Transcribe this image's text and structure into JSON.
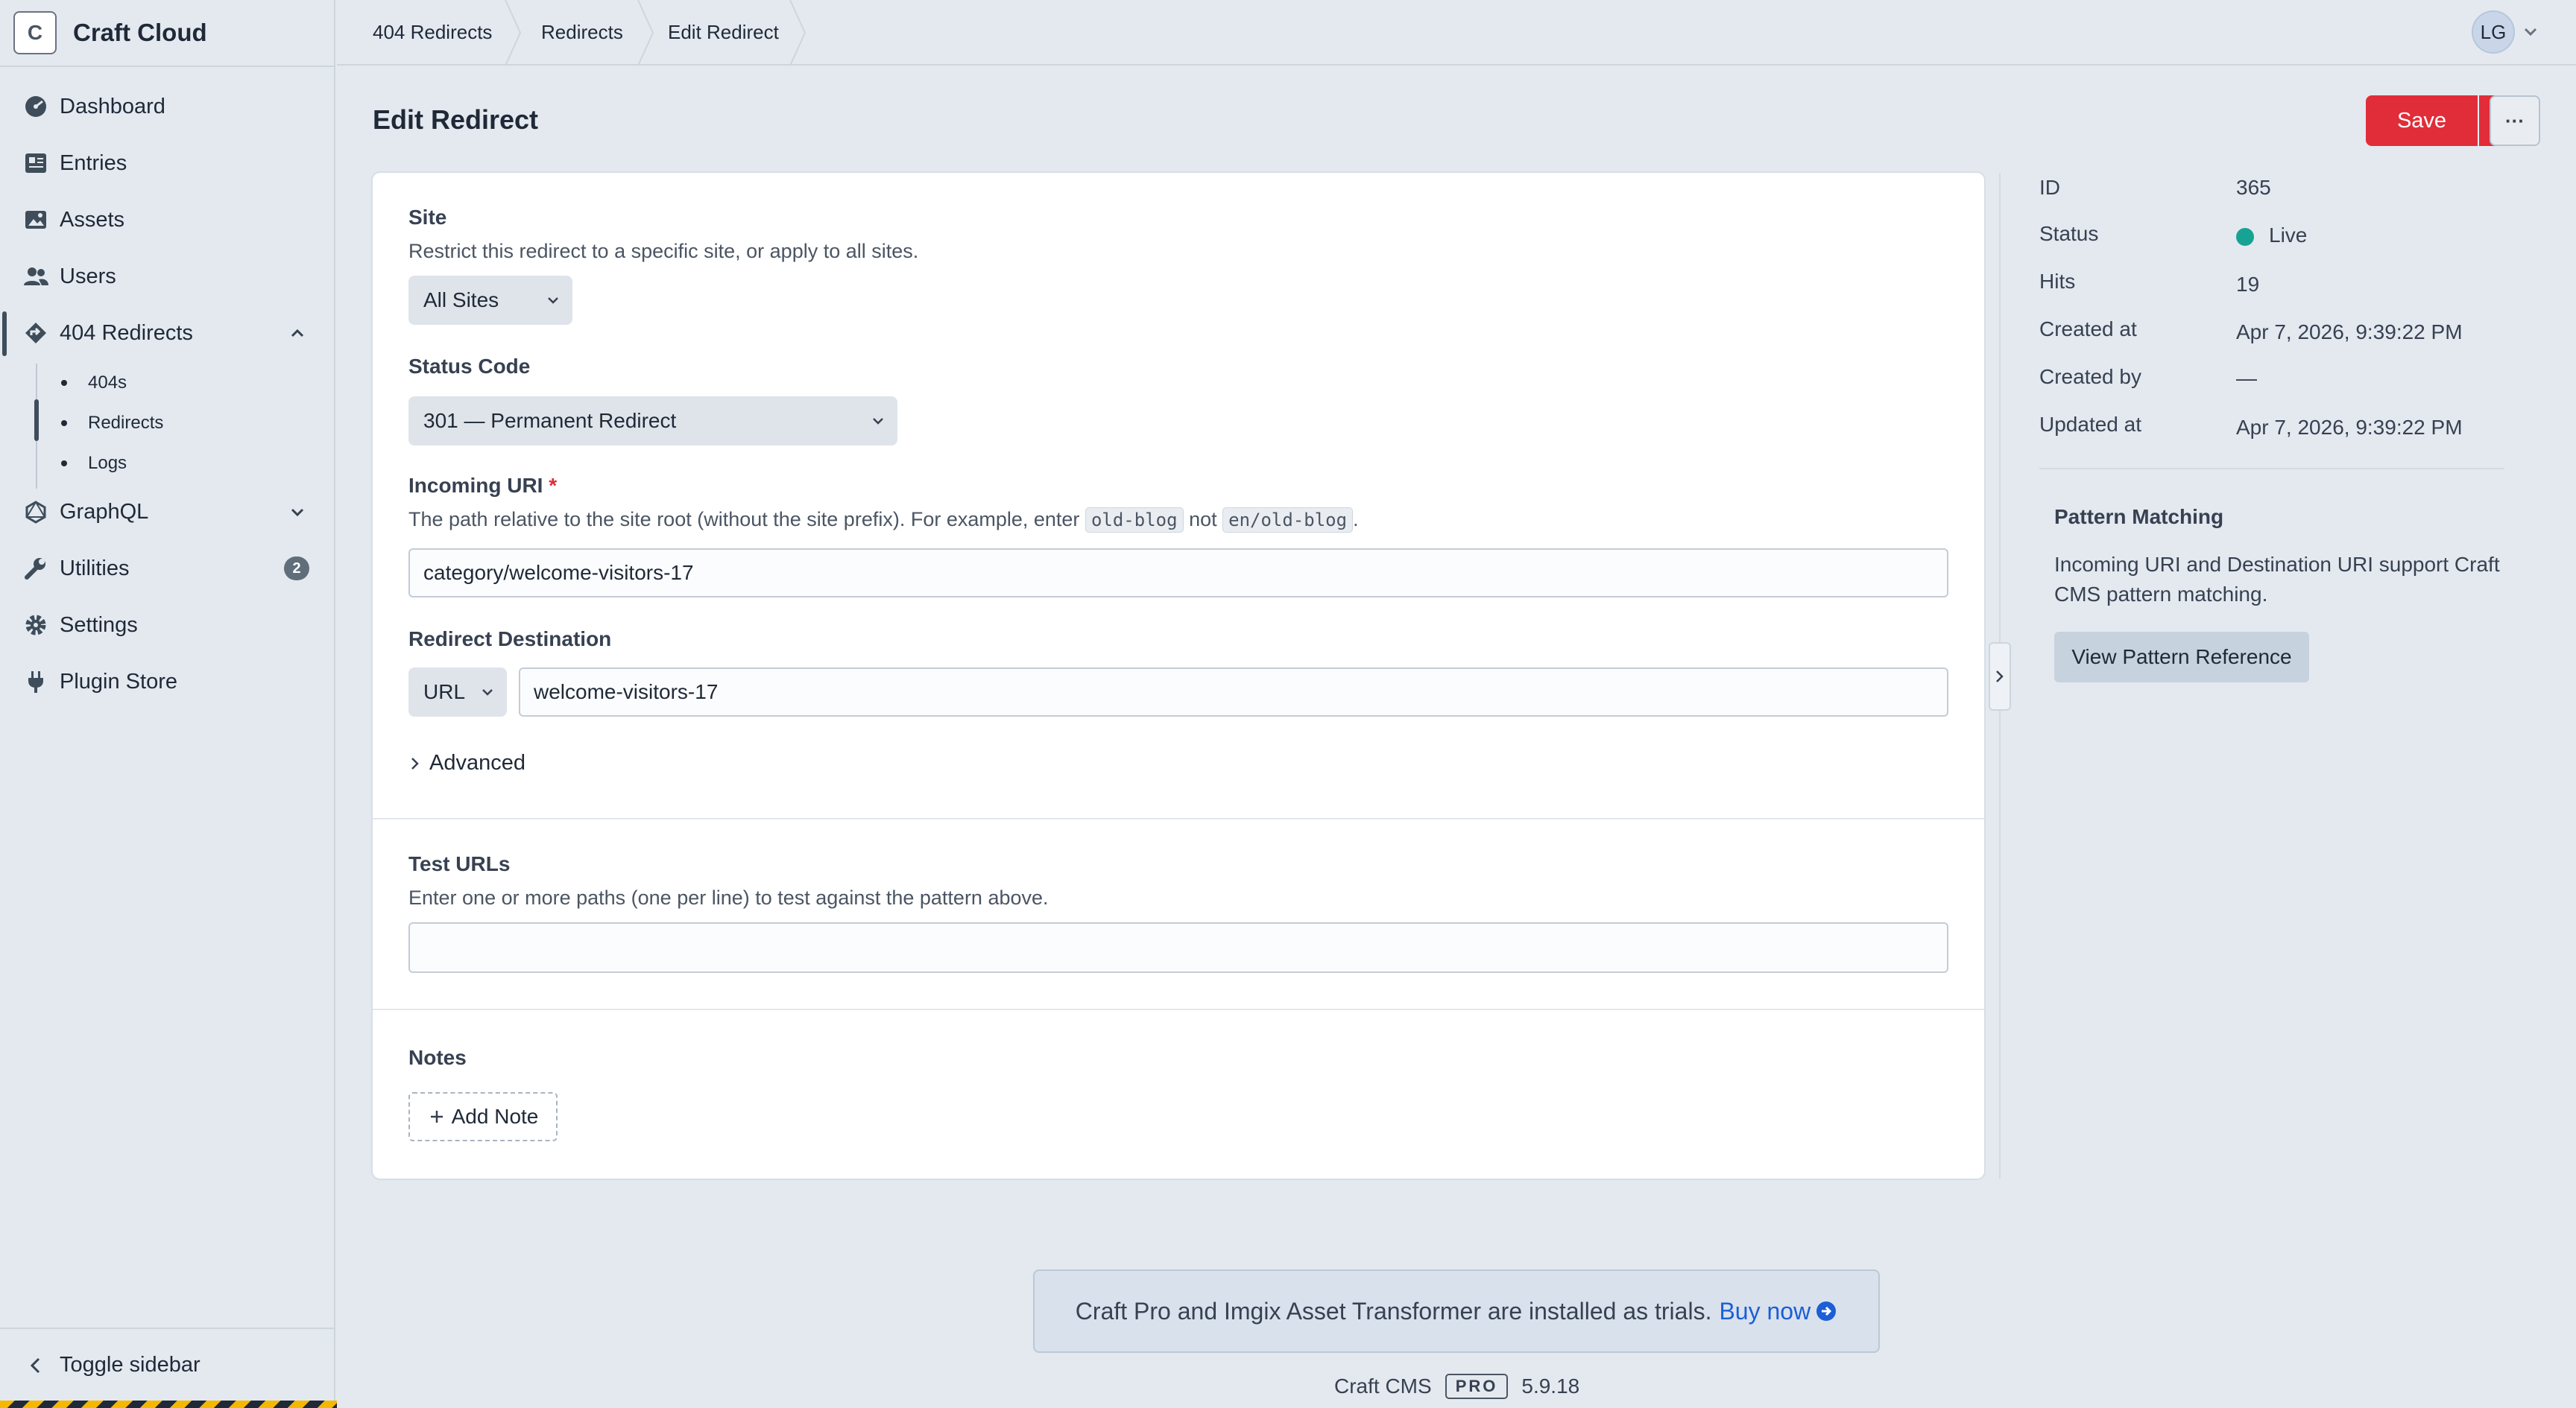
{
  "app": {
    "name": "Craft Cloud",
    "logo_letter": "C"
  },
  "sidebar": {
    "items": [
      {
        "label": "Dashboard",
        "icon": "dashboard-icon"
      },
      {
        "label": "Entries",
        "icon": "entries-icon"
      },
      {
        "label": "Assets",
        "icon": "assets-icon"
      },
      {
        "label": "Users",
        "icon": "users-icon"
      },
      {
        "label": "404 Redirects",
        "icon": "redirects-icon"
      },
      {
        "label": "GraphQL",
        "icon": "graphql-icon"
      },
      {
        "label": "Utilities",
        "icon": "wrench-icon",
        "badge": "2"
      },
      {
        "label": "Settings",
        "icon": "gear-icon"
      },
      {
        "label": "Plugin Store",
        "icon": "plug-icon"
      }
    ],
    "subitems": [
      {
        "label": "404s"
      },
      {
        "label": "Redirects",
        "active": true
      },
      {
        "label": "Logs"
      }
    ],
    "toggle_label": "Toggle sidebar"
  },
  "breadcrumbs": [
    "404 Redirects",
    "Redirects",
    "Edit Redirect"
  ],
  "user": {
    "initials": "LG"
  },
  "page": {
    "title": "Edit Redirect"
  },
  "actions": {
    "save_label": "Save",
    "more_label": "···"
  },
  "form": {
    "site": {
      "label": "Site",
      "hint": "Restrict this redirect to a specific site, or apply to all sites.",
      "value": "All Sites"
    },
    "status_code": {
      "label": "Status Code",
      "value": "301 — Permanent Redirect"
    },
    "incoming_uri": {
      "label": "Incoming URI",
      "required_mark": "*",
      "hint_before": "The path relative to the site root (without the site prefix). For example, enter",
      "hint_code1": "old-blog",
      "hint_mid": "not",
      "hint_code2": "en/old-blog",
      "hint_after": ".",
      "value": "category/welcome-visitors-17"
    },
    "destination": {
      "label": "Redirect Destination",
      "type_value": "URL",
      "value": "welcome-visitors-17"
    },
    "advanced_label": "Advanced",
    "test_urls": {
      "label": "Test URLs",
      "hint": "Enter one or more paths (one per line) to test against the pattern above.",
      "value": ""
    },
    "notes": {
      "label": "Notes",
      "add_label": "Add Note"
    }
  },
  "meta": {
    "id_label": "ID",
    "id_value": "365",
    "status_label": "Status",
    "status_value": "Live",
    "hits_label": "Hits",
    "hits_value": "19",
    "created_at_label": "Created at",
    "created_at_value": "Apr 7, 2026, 9:39:22 PM",
    "created_by_label": "Created by",
    "created_by_value": "—",
    "updated_at_label": "Updated at",
    "updated_at_value": "Apr 7, 2026, 9:39:22 PM",
    "status_color": "#16a394"
  },
  "pattern_matching": {
    "title": "Pattern Matching",
    "text": "Incoming URI and Destination URI support Craft CMS pattern matching.",
    "button_label": "View Pattern Reference"
  },
  "trial_notice": {
    "text": "Craft Pro and Imgix Asset Transformer are installed as trials.",
    "link_label": "Buy now"
  },
  "footer": {
    "product": "Craft CMS",
    "edition": "PRO",
    "version": "5.9.18"
  },
  "colors": {
    "accent_red": "#e12d39",
    "link_blue": "#1b5ed6",
    "background": "#e4e9f0"
  }
}
